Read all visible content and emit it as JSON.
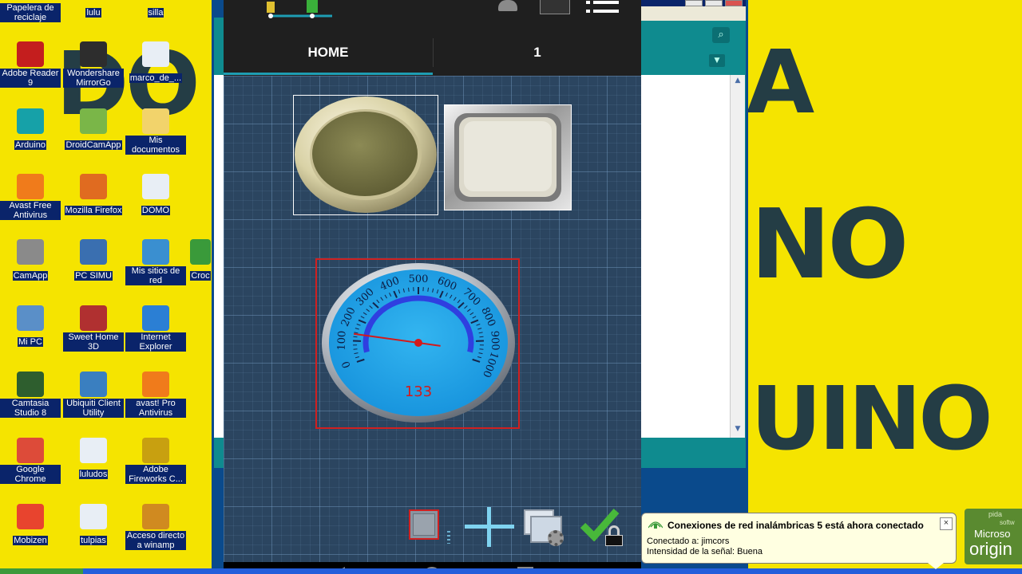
{
  "desktop": {
    "background_letters": [
      "DO",
      "A",
      "NO",
      "UINO"
    ],
    "icons": [
      {
        "label": "Papelera de reciclaje",
        "icon": "recycle-bin-icon",
        "color": "#4a7a9a"
      },
      {
        "label": "lulu",
        "icon": "file-icon",
        "color": "#dfe8f2"
      },
      {
        "label": "silla",
        "icon": "file-icon",
        "color": "#dfe8f2"
      },
      {
        "label": "Adobe Reader 9",
        "icon": "adobe-reader-icon",
        "color": "#c41e1e"
      },
      {
        "label": "Wondershare MirrorGo",
        "icon": "mirrorgo-icon",
        "color": "#2d2d2d"
      },
      {
        "label": "marco_de_...",
        "icon": "image-file-icon",
        "color": "#e8eef5"
      },
      {
        "label": "Arduino",
        "icon": "arduino-icon",
        "color": "#16a1a8"
      },
      {
        "label": "DroidCamApp",
        "icon": "droidcam-icon",
        "color": "#7ab648"
      },
      {
        "label": "Mis documentos",
        "icon": "folder-icon",
        "color": "#f2d36b"
      },
      {
        "label": "Avast Free Antivirus",
        "icon": "avast-icon",
        "color": "#f07b1b"
      },
      {
        "label": "Mozilla Firefox",
        "icon": "firefox-icon",
        "color": "#e06b20"
      },
      {
        "label": "DOMO",
        "icon": "image-file-icon",
        "color": "#e8eef5"
      },
      {
        "label": "CamApp",
        "icon": "camera-icon",
        "color": "#8a8a8a"
      },
      {
        "label": "PC SIMU",
        "icon": "computer-icon",
        "color": "#3a6fb0"
      },
      {
        "label": "Mis sitios de red",
        "icon": "network-icon",
        "color": "#3a8fd0"
      },
      {
        "label": "Mi PC",
        "icon": "my-computer-icon",
        "color": "#5a8fc8"
      },
      {
        "label": "Sweet Home 3D",
        "icon": "sweet-home-icon",
        "color": "#b03030"
      },
      {
        "label": "Internet Explorer",
        "icon": "internet-explorer-icon",
        "color": "#2b7fd4"
      },
      {
        "label": "Camtasia Studio 8",
        "icon": "camtasia-icon",
        "color": "#2e5e2e"
      },
      {
        "label": "Ubiquiti Client Utility",
        "icon": "ubiquiti-icon",
        "color": "#3a7fc0"
      },
      {
        "label": "avast! Pro Antivirus",
        "icon": "avast-icon",
        "color": "#f07b1b"
      },
      {
        "label": "Google Chrome",
        "icon": "chrome-icon",
        "color": "#dd4b39"
      },
      {
        "label": "luludos",
        "icon": "image-file-icon",
        "color": "#e8eef5"
      },
      {
        "label": "Adobe Fireworks C...",
        "icon": "fireworks-icon",
        "color": "#c8a010"
      },
      {
        "label": "Mobizen",
        "icon": "mobizen-icon",
        "color": "#e8442e"
      },
      {
        "label": "tulpias",
        "icon": "image-file-icon",
        "color": "#e8eef5"
      },
      {
        "label": "Acceso directo a winamp",
        "icon": "winamp-icon",
        "color": "#d08a20"
      }
    ],
    "partial_icon_label": "Croc"
  },
  "phone": {
    "tabs": [
      {
        "label": "HOME",
        "active": true
      },
      {
        "label": "1",
        "active": false
      }
    ],
    "gauge": {
      "min": 0,
      "max": 1000,
      "value": 133,
      "readout": "133",
      "tick_labels": [
        "0",
        "100",
        "200",
        "300",
        "400",
        "500",
        "600",
        "700",
        "800",
        "900",
        "1000"
      ]
    },
    "widgets": [
      "round-led-button",
      "square-push-button",
      "analog-gauge"
    ],
    "toolbar": [
      "widget-color-button",
      "add-widget-button",
      "widget-settings-button",
      "confirm-lock-button"
    ]
  },
  "notification": {
    "title": "Conexiones de red inalámbricas 5 está ahora conectado",
    "line1": "Conectado a: jimcors",
    "line2": "Intensidad de la señal: Buena",
    "close": "×"
  },
  "ms_badge": {
    "text_top": "pida",
    "text_small": "softw",
    "brand": "Microso",
    "word": "origin"
  },
  "colors": {
    "desktop_bg": "#f5e400",
    "icon_label_bg": "#0a246a",
    "phone_topbar": "#1f1f1f",
    "tab_accent": "#1e9db3",
    "gauge_face": "#1aa0e8",
    "selection_red": "#d02020"
  }
}
